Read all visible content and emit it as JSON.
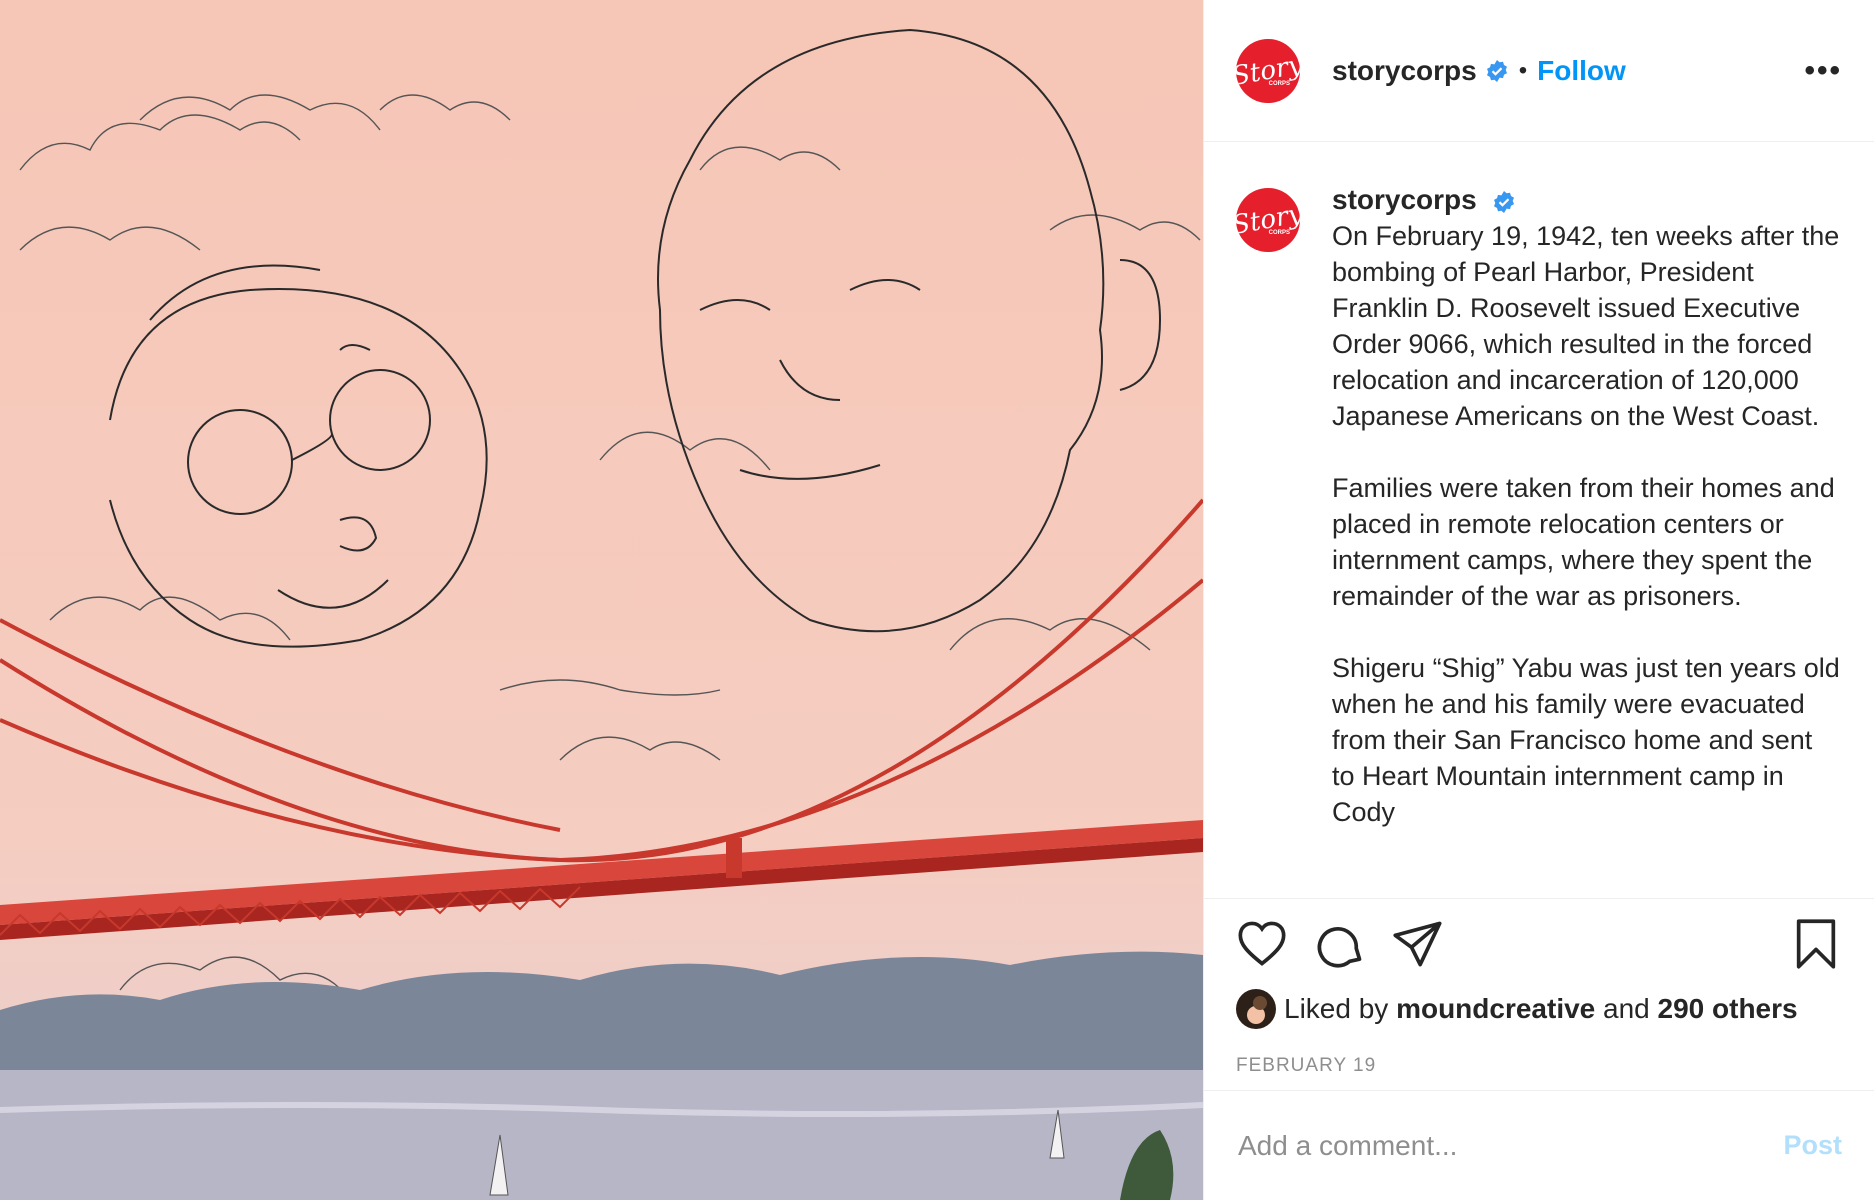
{
  "header": {
    "username": "storycorps",
    "separator": "•",
    "follow_label": "Follow",
    "more_label": "•••",
    "avatar_logo": "Story",
    "avatar_logo_sub": "CORPS"
  },
  "caption": {
    "username": "storycorps",
    "paragraphs": [
      "On February 19, 1942, ten weeks after the bombing of Pearl Harbor, President Franklin D. Roosevelt issued Executive Order 9066, which resulted in the forced relocation and incarceration of 120,000 Japanese Americans on the West Coast.",
      "Families were taken from their homes and placed in remote relocation centers or internment camps, where they spent the remainder of the war as prisoners.",
      "Shigeru “Shig” Yabu was just ten years old when he and his family were evacuated from their San Francisco home and sent to Heart Mountain internment camp in Cody"
    ]
  },
  "actions": {
    "icons": [
      "heart-icon",
      "comment-icon",
      "share-icon",
      "bookmark-icon"
    ]
  },
  "likes": {
    "prefix": "Liked by",
    "liker": "moundcreative",
    "conjunction": "and",
    "others": "290 others"
  },
  "date": "FEBRUARY 19",
  "comment": {
    "placeholder": "Add a comment...",
    "post_label": "Post"
  },
  "colors": {
    "brand_red": "#e51f2c",
    "link_blue": "#0095f6",
    "post_disabled": "#b2dffc",
    "bridge_red": "#c8382c",
    "sky_pink": "#f6c9bb"
  }
}
